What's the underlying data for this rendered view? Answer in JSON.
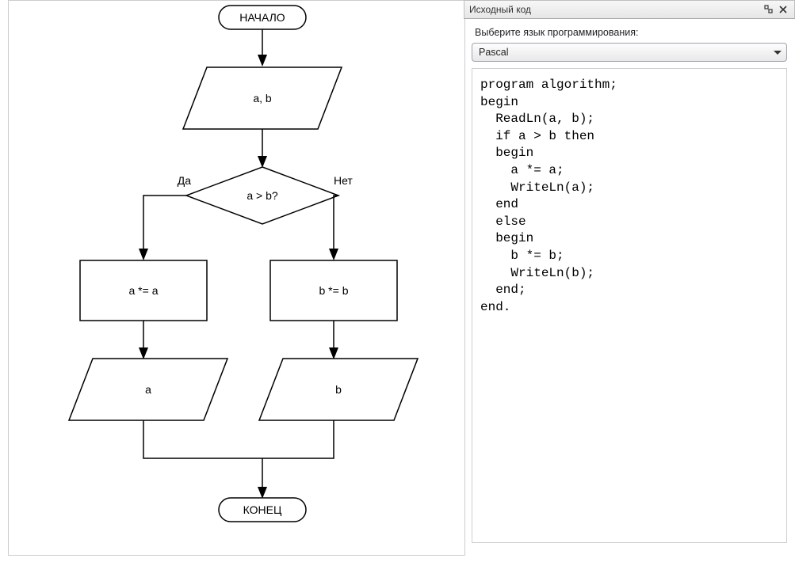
{
  "panel": {
    "title": "Исходный код",
    "lang_label": "Выберите язык программирования:",
    "lang_value": "Pascal"
  },
  "code": "program algorithm;\nbegin\n  ReadLn(a, b);\n  if a > b then\n  begin\n    a *= a;\n    WriteLn(a);\n  end\n  else\n  begin\n    b *= b;\n    WriteLn(b);\n  end;\nend.",
  "flowchart": {
    "start": "НАЧАЛО",
    "end": "КОНЕЦ",
    "input": "a, b",
    "decision": "a > b?",
    "yes": "Да",
    "no": "Нет",
    "left_proc": "a *= a",
    "right_proc": "b *= b",
    "left_out": "a",
    "right_out": "b"
  },
  "icons": {
    "detach": "detach-icon",
    "close": "close-icon",
    "dropdown": "chevron-down-icon"
  }
}
